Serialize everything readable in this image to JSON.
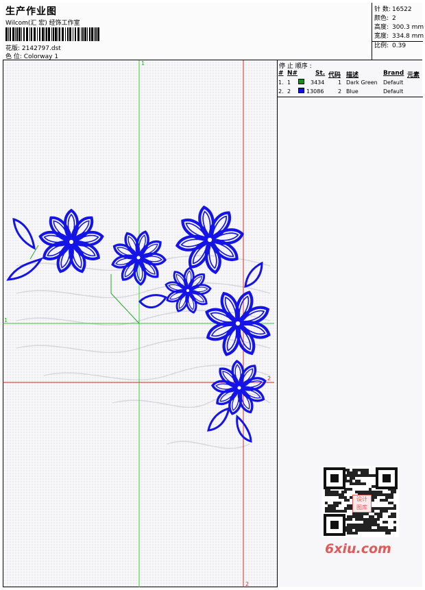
{
  "header": {
    "title": "生产作业图",
    "company": "Wilcom(汇 宏) 经饰工作室",
    "design_label": "花版:",
    "design_value": "2142797.dst",
    "colorway_label": "色 位:",
    "colorway_value": "Colorway 1"
  },
  "stats": [
    {
      "label": "针 数:",
      "value": "16522"
    },
    {
      "label": "颜色:",
      "value": "2"
    },
    {
      "label": "高度:",
      "value": "300.3 mm"
    },
    {
      "label": "宽度:",
      "value": "334.8 mm"
    },
    {
      "label": "比例:",
      "value": "0.39"
    }
  ],
  "stop_sequence": {
    "title": "停 止 顺序 :",
    "headers": {
      "hash": "#",
      "n": "N#",
      "st": "St.",
      "code": "代码",
      "desc": "描述",
      "brand": "Brand",
      "elem": "元素"
    },
    "rows": [
      {
        "idx": "1.",
        "n": "1",
        "st": "3434",
        "code": "1",
        "desc": "Dark Green",
        "brand": "Default",
        "color": "#1a8a1a"
      },
      {
        "idx": "2.",
        "n": "2",
        "st": "13086",
        "code": "2",
        "desc": "Blue",
        "brand": "Default",
        "color": "#1010e0"
      }
    ]
  },
  "markers": {
    "green": "1",
    "red": "2"
  },
  "colors": {
    "thread_blue": "#1414e6",
    "thread_green": "#2aa62a",
    "guide_green": "#33cc33",
    "guide_red": "#e02020"
  },
  "watermark": {
    "text": "6xiu.com",
    "badge": "设计 图库"
  }
}
